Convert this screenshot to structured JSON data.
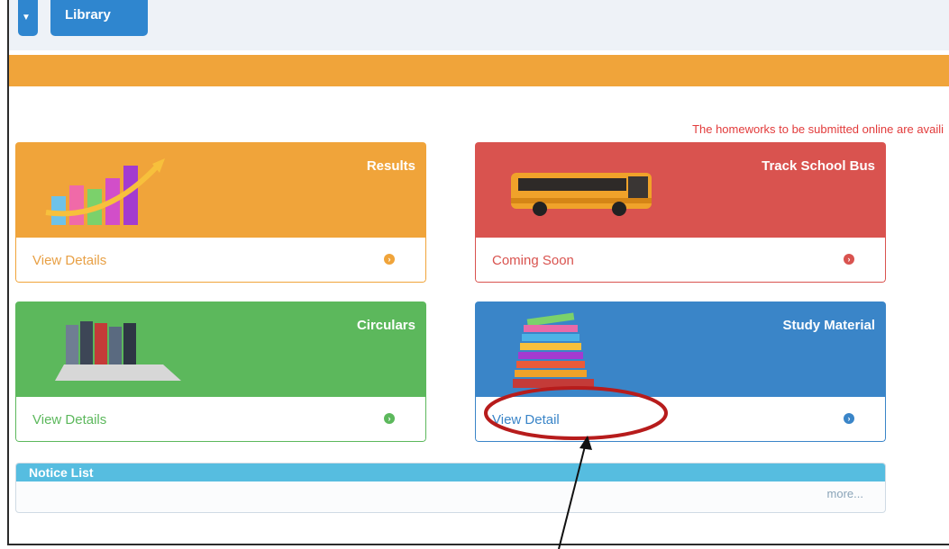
{
  "nav": {
    "library_label": "Library"
  },
  "notice_text": "The homeworks to be submitted online are availi",
  "tiles": [
    {
      "title": "Results",
      "footer": "View Details",
      "color": "#f0a43a",
      "icon": "bar-chart-icon"
    },
    {
      "title": "Track School Bus",
      "footer": "Coming Soon",
      "color": "#d9534f",
      "icon": "school-bus-icon"
    },
    {
      "title": "Circulars",
      "footer": "View Details",
      "color": "#5cb85c",
      "icon": "binders-laptop-icon"
    },
    {
      "title": "Study Material",
      "footer": "View Detail",
      "color": "#3a85c8",
      "icon": "book-stack-icon"
    }
  ],
  "notice_list": {
    "title": "Notice List",
    "more_label": "more..."
  },
  "colors": {
    "nav_blue": "#2f86cf",
    "orange_bar": "#f0a43a",
    "annotation_red": "#b71c1c"
  }
}
